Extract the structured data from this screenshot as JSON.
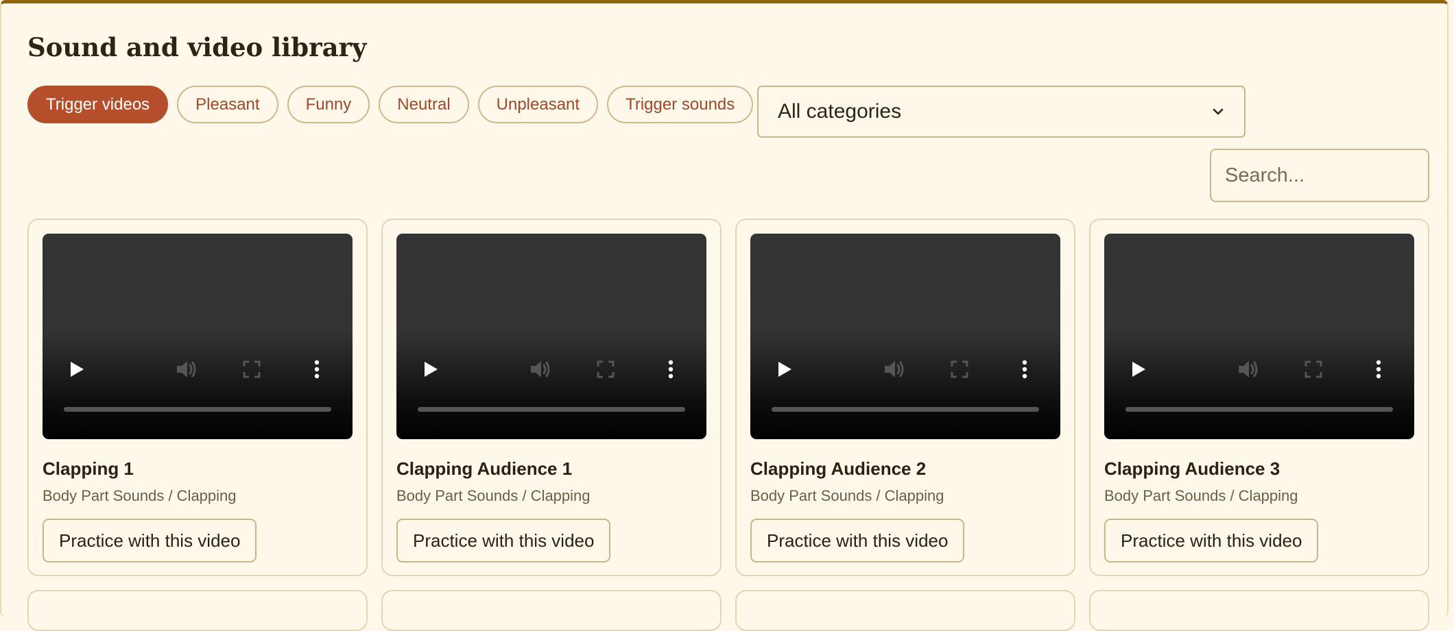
{
  "header": {
    "title": "Sound and video library"
  },
  "tabs": [
    {
      "label": "Trigger videos",
      "active": true
    },
    {
      "label": "Pleasant",
      "active": false
    },
    {
      "label": "Funny",
      "active": false
    },
    {
      "label": "Neutral",
      "active": false
    },
    {
      "label": "Unpleasant",
      "active": false
    },
    {
      "label": "Trigger sounds",
      "active": false
    }
  ],
  "filter": {
    "selected": "All categories"
  },
  "search": {
    "placeholder": "Search..."
  },
  "cards": [
    {
      "title": "Clapping 1",
      "category": "Body Part Sounds / Clapping",
      "button": "Practice with this video"
    },
    {
      "title": "Clapping Audience 1",
      "category": "Body Part Sounds / Clapping",
      "button": "Practice with this video"
    },
    {
      "title": "Clapping Audience 2",
      "category": "Body Part Sounds / Clapping",
      "button": "Practice with this video"
    },
    {
      "title": "Clapping Audience 3",
      "category": "Body Part Sounds / Clapping",
      "button": "Practice with this video"
    }
  ],
  "colors": {
    "accent": "#b54e2b",
    "page_background": "#fdf8ea",
    "border": "#cbb68a",
    "top_rule": "#93650f"
  },
  "icons": {
    "video_controls": [
      "play-icon",
      "volume-icon",
      "fullscreen-icon",
      "more-vertical-icon"
    ],
    "select": "chevron-down-icon"
  }
}
